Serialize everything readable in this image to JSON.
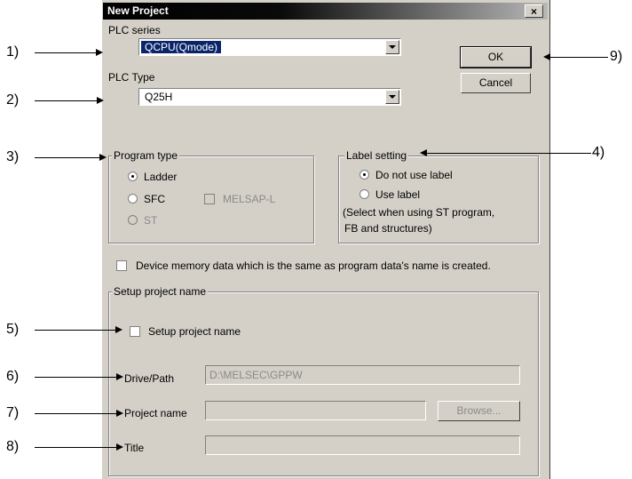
{
  "window": {
    "title": "New Project",
    "close_glyph": "×"
  },
  "plc_series": {
    "label": "PLC series",
    "value": "QCPU(Qmode)"
  },
  "plc_type": {
    "label": "PLC Type",
    "value": "Q25H"
  },
  "buttons": {
    "ok": "OK",
    "cancel": "Cancel",
    "browse": "Browse..."
  },
  "program_type": {
    "title": "Program type",
    "ladder": "Ladder",
    "sfc": "SFC",
    "melsap": "MELSAP-L",
    "st": "ST",
    "selected": "Ladder"
  },
  "label_setting": {
    "title": "Label setting",
    "no_label": "Do not use label",
    "use_label": "Use label",
    "note_line1": "(Select when using ST program,",
    "note_line2": "FB and structures)",
    "selected": "Do not use label"
  },
  "device_memory": {
    "label": "Device memory data which is the same as program data's name is created.",
    "checked": false
  },
  "setup_project": {
    "group_title": "Setup project name",
    "checkbox_label": "Setup project name",
    "checked": false,
    "drive_path_label": "Drive/Path",
    "drive_path_value": "D:\\MELSEC\\GPPW",
    "project_name_label": "Project name",
    "project_name_value": "",
    "title_label": "Title",
    "title_value": ""
  },
  "annotations": [
    "1)",
    "2)",
    "3)",
    "4)",
    "5)",
    "6)",
    "7)",
    "8)",
    "9)"
  ]
}
